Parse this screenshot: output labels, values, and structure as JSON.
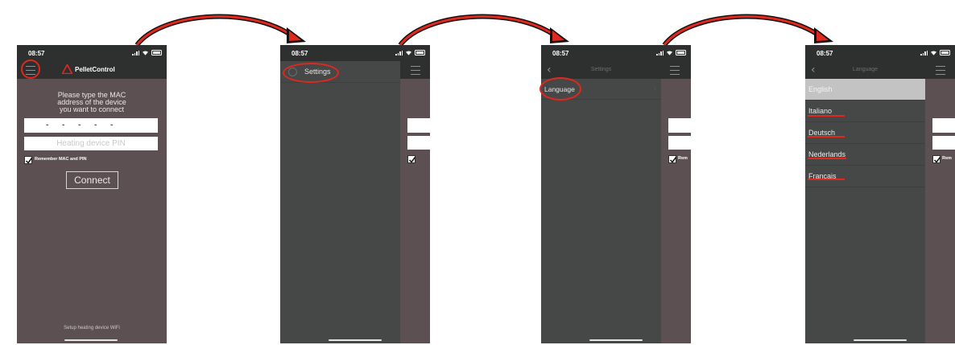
{
  "status": {
    "time": "08:57"
  },
  "screen1": {
    "app_name": "PelletControl",
    "prompt_lines": [
      "Please type the MAC",
      "address of the device",
      "you want to connect"
    ],
    "mac_placeholder": "-      -      -      -      -",
    "pin_placeholder": "Heating device PIN",
    "remember_label": "Remember MAC and PIN",
    "connect_label": "Connect",
    "setup_wifi_label": "Setup heating device WiFi"
  },
  "screen2": {
    "menu_items": [
      {
        "label": "Settings",
        "icon": "settings-circle-icon"
      }
    ]
  },
  "screen3": {
    "title": "Settings",
    "items": [
      {
        "label": "Language"
      }
    ]
  },
  "screen4": {
    "title": "Language",
    "languages": [
      "English",
      "Italiano",
      "Deutsch",
      "Nederlands",
      "Français"
    ],
    "selected": "English",
    "peek_label": "Rem"
  },
  "colors": {
    "accent_red": "#e0281e",
    "app_bar": "#2e302f",
    "mauve_background": "#5c5053",
    "drawer": "#454847"
  }
}
